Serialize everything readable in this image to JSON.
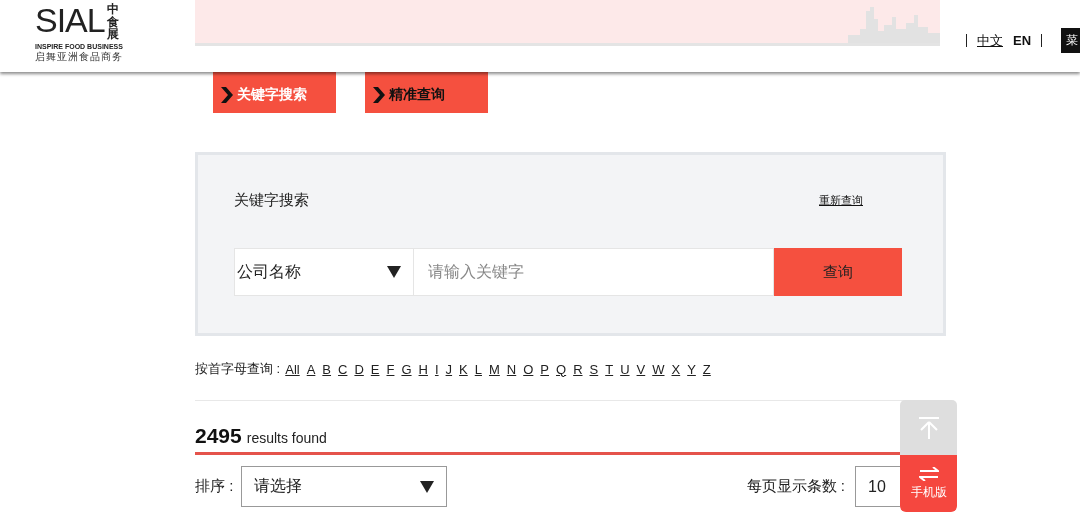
{
  "header": {
    "logo": {
      "wordmark": "SIAL",
      "cn_mark": "中食展",
      "tagline": "INSPIRE FOOD BUSINESS",
      "cn_tagline": "启舞亚洲食品商务"
    },
    "languages": [
      {
        "label": "中文",
        "selected": true
      },
      {
        "label": "EN",
        "selected": false
      }
    ],
    "menu_button": "菜"
  },
  "tabs": [
    {
      "label": "关键字搜索",
      "selected": true
    },
    {
      "label": "精准查询",
      "selected": false
    }
  ],
  "search": {
    "title": "关键字搜索",
    "reset_link": "重新查询",
    "field_select": "公司名称",
    "placeholder": "请输入关键字",
    "button": "查询"
  },
  "letter_filter": {
    "label": "按首字母查询 :",
    "letters": [
      "All",
      "A",
      "B",
      "C",
      "D",
      "E",
      "F",
      "G",
      "H",
      "I",
      "J",
      "K",
      "L",
      "M",
      "N",
      "O",
      "P",
      "Q",
      "R",
      "S",
      "T",
      "U",
      "V",
      "W",
      "X",
      "Y",
      "Z"
    ]
  },
  "results": {
    "count": "2495",
    "label": "results found"
  },
  "sort": {
    "label": "排序 :",
    "select": "请选择",
    "per_page_label": "每页显示条数 :",
    "per_page": "10"
  },
  "floating": {
    "mobile_label": "手机版"
  }
}
